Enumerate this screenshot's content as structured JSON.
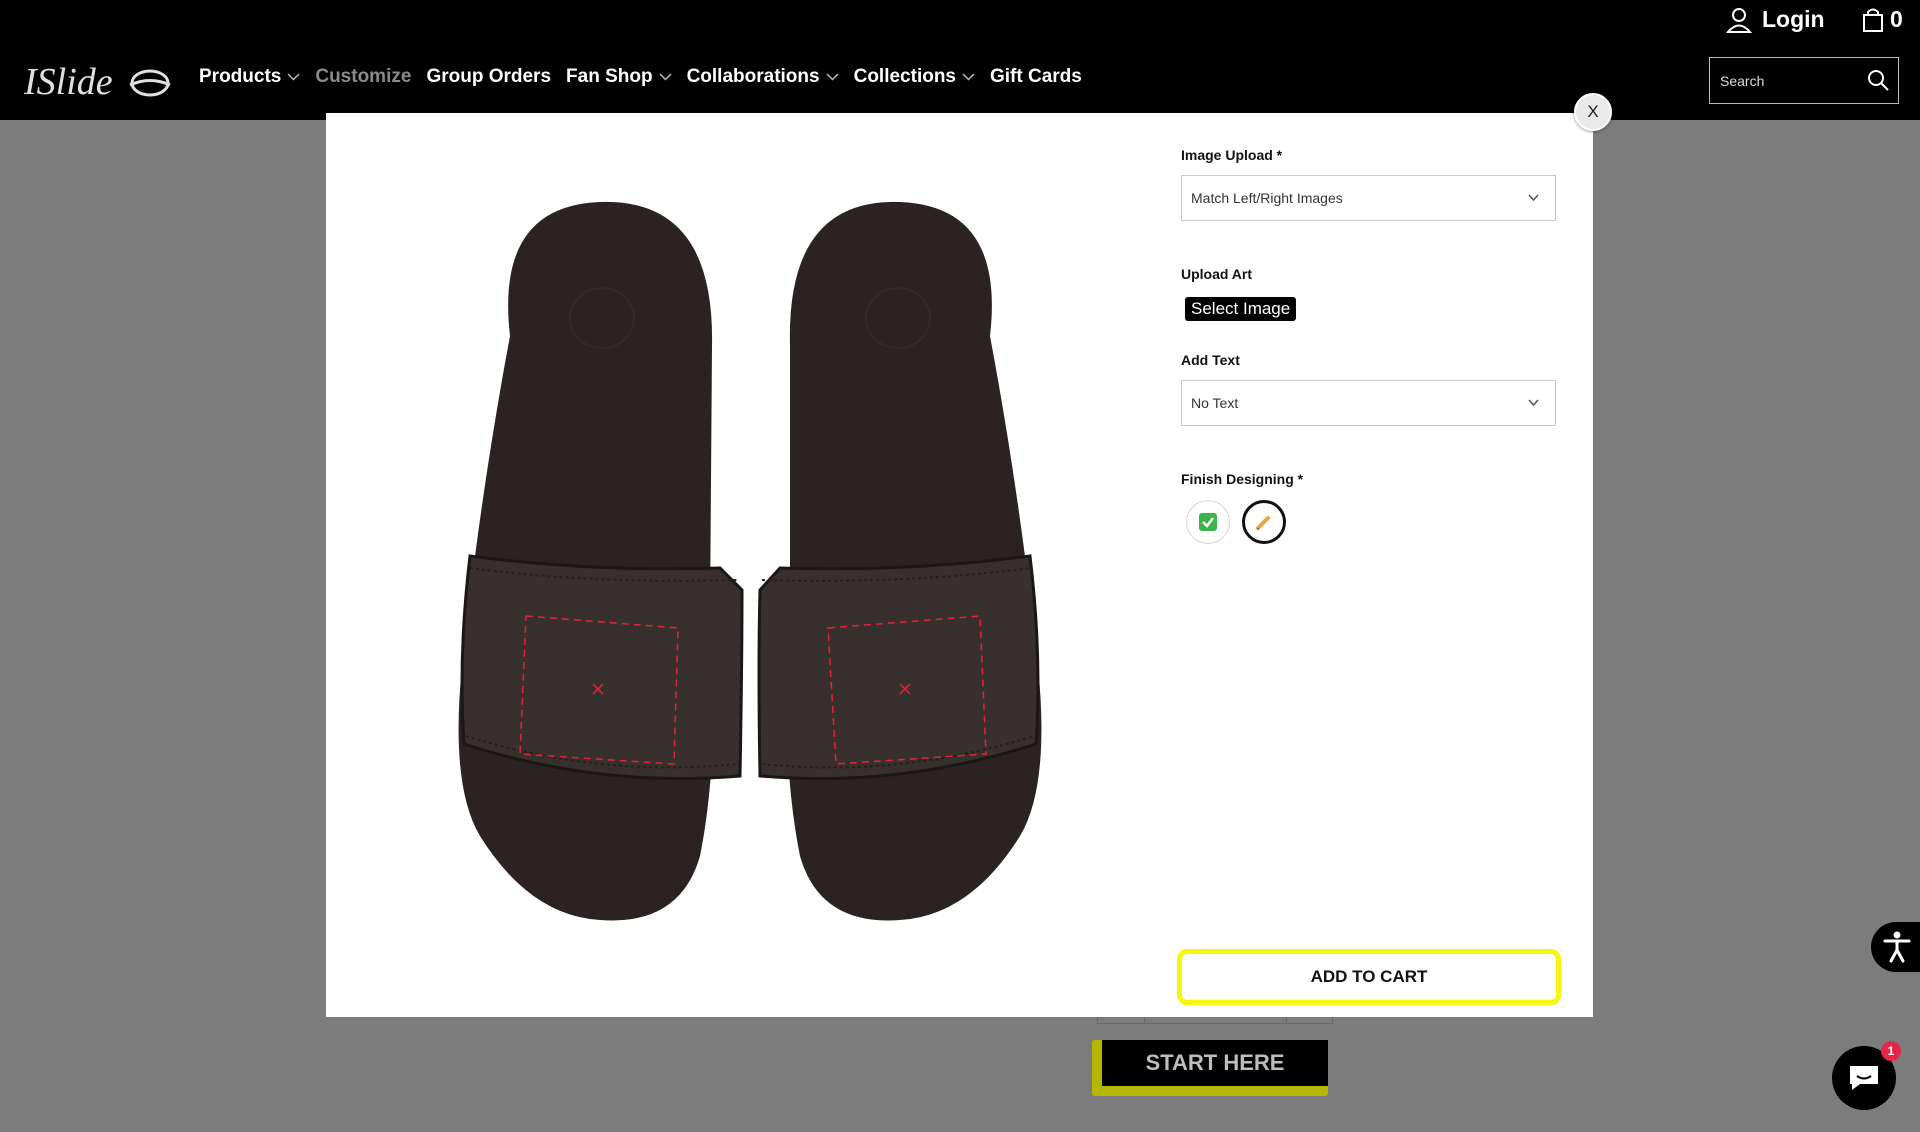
{
  "header": {
    "logo_text": "ISlide",
    "nav": [
      {
        "label": "Products",
        "has_dropdown": true,
        "dimmed": false
      },
      {
        "label": "Customize",
        "has_dropdown": false,
        "dimmed": true
      },
      {
        "label": "Group Orders",
        "has_dropdown": false,
        "dimmed": false
      },
      {
        "label": "Fan Shop",
        "has_dropdown": true,
        "dimmed": false
      },
      {
        "label": "Collaborations",
        "has_dropdown": true,
        "dimmed": false
      },
      {
        "label": "Collections",
        "has_dropdown": true,
        "dimmed": false
      },
      {
        "label": "Gift Cards",
        "has_dropdown": false,
        "dimmed": false
      }
    ],
    "login_label": "Login",
    "cart_count": "0",
    "search_placeholder": "Search",
    "icons": {
      "user": "user-icon",
      "cart": "shopping-bag-icon",
      "search": "search-icon"
    }
  },
  "modal": {
    "close_label": "X",
    "image_upload": {
      "label": "Image Upload *",
      "value": "Match Left/Right Images"
    },
    "upload_art": {
      "label": "Upload Art",
      "button_label": "Select Image"
    },
    "add_text": {
      "label": "Add Text",
      "value": "No Text"
    },
    "finish_designing": {
      "label": "Finish Designing *",
      "options": [
        {
          "name": "done",
          "icon": "check-mark-icon",
          "glyph": "✅",
          "selected": false
        },
        {
          "name": "edit",
          "icon": "pencil-icon",
          "glyph": "✏",
          "selected": true
        }
      ]
    },
    "add_to_cart_label": "ADD TO CART",
    "accent_color": "#f6f60e"
  },
  "page": {
    "start_label": "START HERE"
  },
  "chat": {
    "badge_count": "1"
  },
  "colors": {
    "header_bg": "#000000",
    "overlay": "#7c7c7c",
    "slide_body": "#2a2322",
    "design_area": "#e0243a"
  }
}
